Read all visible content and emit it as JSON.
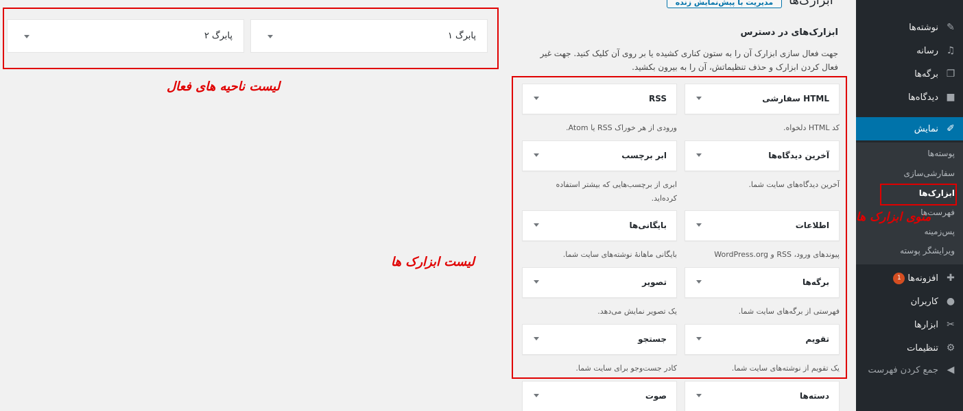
{
  "header": {
    "title": "ابزارک‌ها",
    "manage_button": "مدیریت با پیش‌نمایش زنده"
  },
  "sidebar": {
    "items": [
      {
        "label": "نوشته‌ها",
        "icon": "pin-icon"
      },
      {
        "label": "رسانه",
        "icon": "media-icon"
      },
      {
        "label": "برگه‌ها",
        "icon": "pages-icon"
      },
      {
        "label": "دیدگاه‌ها",
        "icon": "comments-icon"
      },
      {
        "label": "نمایش",
        "icon": "appearance-icon"
      },
      {
        "label": "افزونه‌ها",
        "icon": "plugins-icon",
        "badge": "1"
      },
      {
        "label": "کاربران",
        "icon": "users-icon"
      },
      {
        "label": "ابزارها",
        "icon": "tools-icon"
      },
      {
        "label": "تنظیمات",
        "icon": "settings-icon"
      },
      {
        "label": "جمع کردن فهرست",
        "icon": "collapse-icon"
      }
    ],
    "submenu": [
      {
        "label": "پوسته‌ها"
      },
      {
        "label": "سفارشی‌سازی"
      },
      {
        "label": "ابزارک‌ها"
      },
      {
        "label": "فهرست‌ها"
      },
      {
        "label": "پس‌زمینه"
      },
      {
        "label": "ویرایشگر پوسته"
      }
    ]
  },
  "available": {
    "title": "ابزارک‌های در دسترس",
    "description": "جهت فعال سازی ابزارک آن را به ستون کناری کشیده یا بر روی آن کلیک کنید. جهت غیر فعال کردن ابزارک و حذف تنظیماتش، آن را به بیرون بکشید.",
    "widgets": [
      {
        "title": "HTML سفارشی",
        "desc": "کد HTML دلخواه."
      },
      {
        "title": "RSS",
        "desc": "ورودی از هر خوراک RSS یا Atom."
      },
      {
        "title": "آخرین دیدگاه‌ها",
        "desc": "آخرین دیدگاه‌های سایت شما."
      },
      {
        "title": "ابر برچسب",
        "desc": "ابری از برچسب‌هایی که بیشتر استفاده کرده‌اید."
      },
      {
        "title": "اطلاعات",
        "desc": "پیوندهای ورود، RSS و WordPress.org"
      },
      {
        "title": "بایگانی‌ها",
        "desc": "بایگانی ماهانهٔ نوشته‌های سایت شما."
      },
      {
        "title": "برگه‌ها",
        "desc": "فهرستی از برگه‌های سایت شما."
      },
      {
        "title": "تصویر",
        "desc": "یک تصویر نمایش می‌دهد."
      },
      {
        "title": "تقویم",
        "desc": "یک تقویم از نوشته‌های سایت شما."
      },
      {
        "title": "جستجو",
        "desc": "کادر جست‌وجو برای سایت شما."
      },
      {
        "title": "دسته‌ها",
        "desc": ""
      },
      {
        "title": "صوت",
        "desc": ""
      }
    ]
  },
  "areas": [
    {
      "title": "پابرگ ۱"
    },
    {
      "title": "پابرگ ۲"
    }
  ],
  "annotations": {
    "active_areas": "لیست ناحیه های فعال",
    "widgets_list": "لیست ابزارک ها",
    "widgets_menu": "منوی ابزارک ها"
  },
  "colors": {
    "sidebar_bg": "#23282d",
    "active_menu": "#0073aa",
    "annotation_red": "#e00000",
    "badge": "#d54e21"
  }
}
